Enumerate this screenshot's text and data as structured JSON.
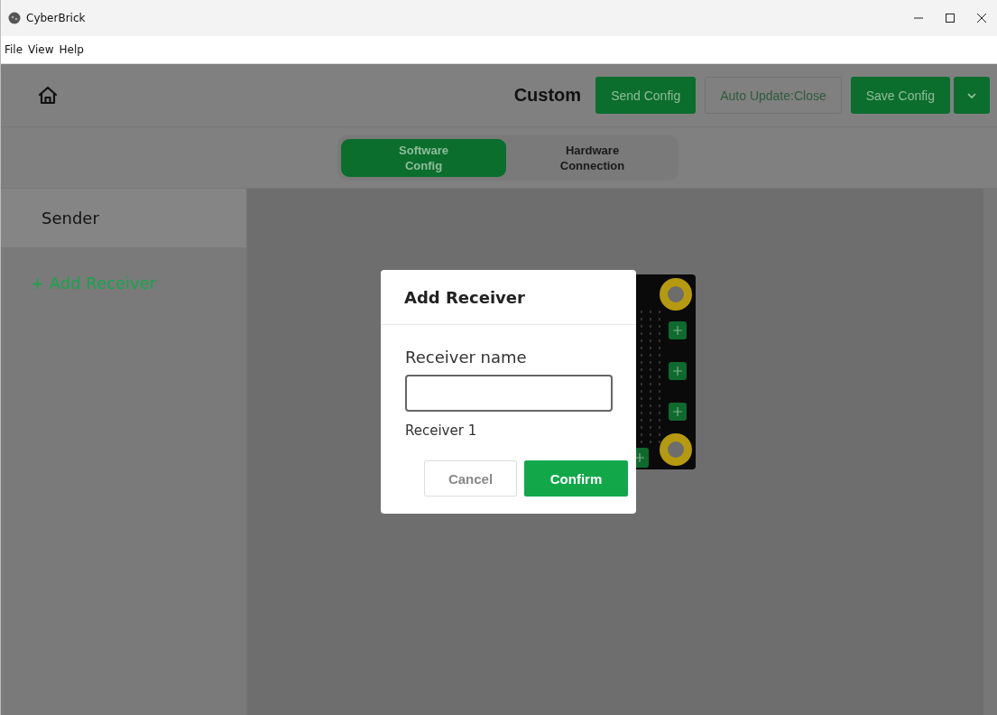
{
  "window": {
    "title": "CyberBrick"
  },
  "menu": [
    "File",
    "View",
    "Help"
  ],
  "header": {
    "title": "Custom",
    "buttons": [
      {
        "label": "Send Config",
        "kind": "primary"
      },
      {
        "label": "Auto Update:Close",
        "kind": "outline"
      },
      {
        "label": "Save Config",
        "kind": "primary"
      },
      {
        "kind": "caret"
      }
    ]
  },
  "tabs": [
    {
      "label": "Software Config",
      "selected": true
    },
    {
      "label": "Hardware Connection",
      "selected": false
    }
  ],
  "sidebar": {
    "items": [
      {
        "label": "Sender",
        "kind": "item",
        "selected": true
      },
      {
        "label": "+ Add Receiver",
        "kind": "link",
        "selected": false
      }
    ]
  },
  "dialog": {
    "title": "Add Receiver",
    "field_label": "Receiver name",
    "hint": "Receiver 1",
    "buttons": [
      {
        "label": "Cancel",
        "kind": "secondary"
      },
      {
        "label": "Confirm",
        "kind": "primary"
      }
    ]
  }
}
